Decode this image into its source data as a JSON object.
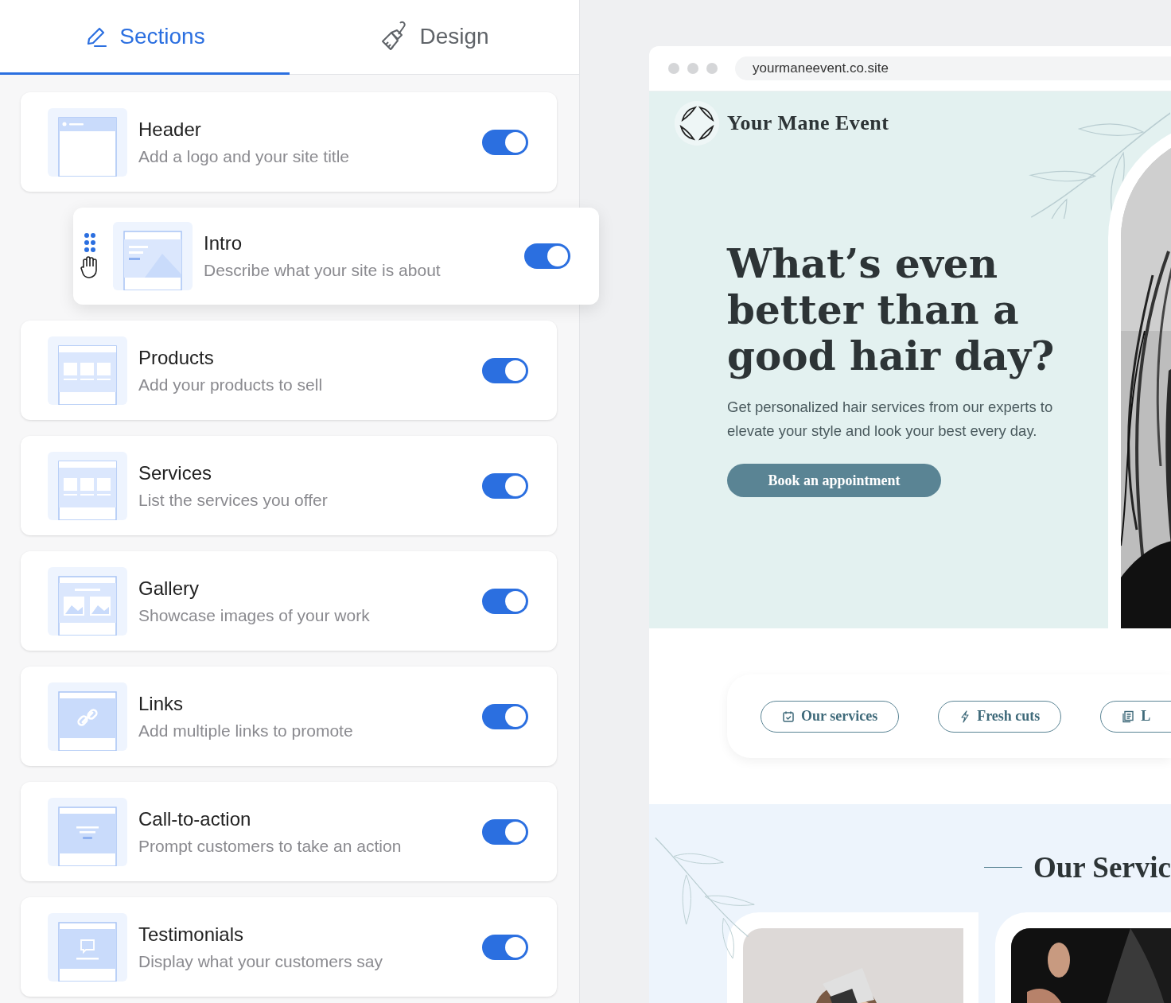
{
  "tabs": [
    {
      "label": "Sections",
      "kind": "pencil",
      "selected": true
    },
    {
      "label": "Design",
      "kind": "brush",
      "selected": false
    }
  ],
  "sections": [
    {
      "title": "Header",
      "description": "Add a logo and your site title",
      "kind": "header",
      "enabled": true,
      "dragging": false
    },
    {
      "title": "Intro",
      "description": "Describe what your site is about",
      "kind": "intro",
      "enabled": true,
      "dragging": true
    },
    {
      "title": "Products",
      "description": "Add your products to sell",
      "kind": "grid",
      "enabled": true,
      "dragging": false
    },
    {
      "title": "Services",
      "description": "List the services you offer",
      "kind": "grid",
      "enabled": true,
      "dragging": false
    },
    {
      "title": "Gallery",
      "description": "Showcase images of your work",
      "kind": "gallery",
      "enabled": true,
      "dragging": false
    },
    {
      "title": "Links",
      "description": "Add multiple links to promote",
      "kind": "link",
      "enabled": true,
      "dragging": false
    },
    {
      "title": "Call-to-action",
      "description": "Prompt customers to take an action",
      "kind": "cta",
      "enabled": true,
      "dragging": false
    },
    {
      "title": "Testimonials",
      "description": "Display what your customers say",
      "kind": "quote",
      "enabled": true,
      "dragging": false
    }
  ],
  "preview": {
    "url": "yourmaneevent.co.site",
    "site_name": "Your Mane Event",
    "hero": {
      "heading": "What’s even better than a good hair day?",
      "text": "Get personalized hair services from our experts to elevate your style and look your best every day.",
      "button": "Book an appointment"
    },
    "nav_pills": [
      {
        "label": "Our services",
        "kind": "calendar"
      },
      {
        "label": "Fresh cuts",
        "kind": "bolt"
      },
      {
        "label": "L",
        "kind": "document"
      }
    ],
    "services_heading": "Our Servic"
  }
}
